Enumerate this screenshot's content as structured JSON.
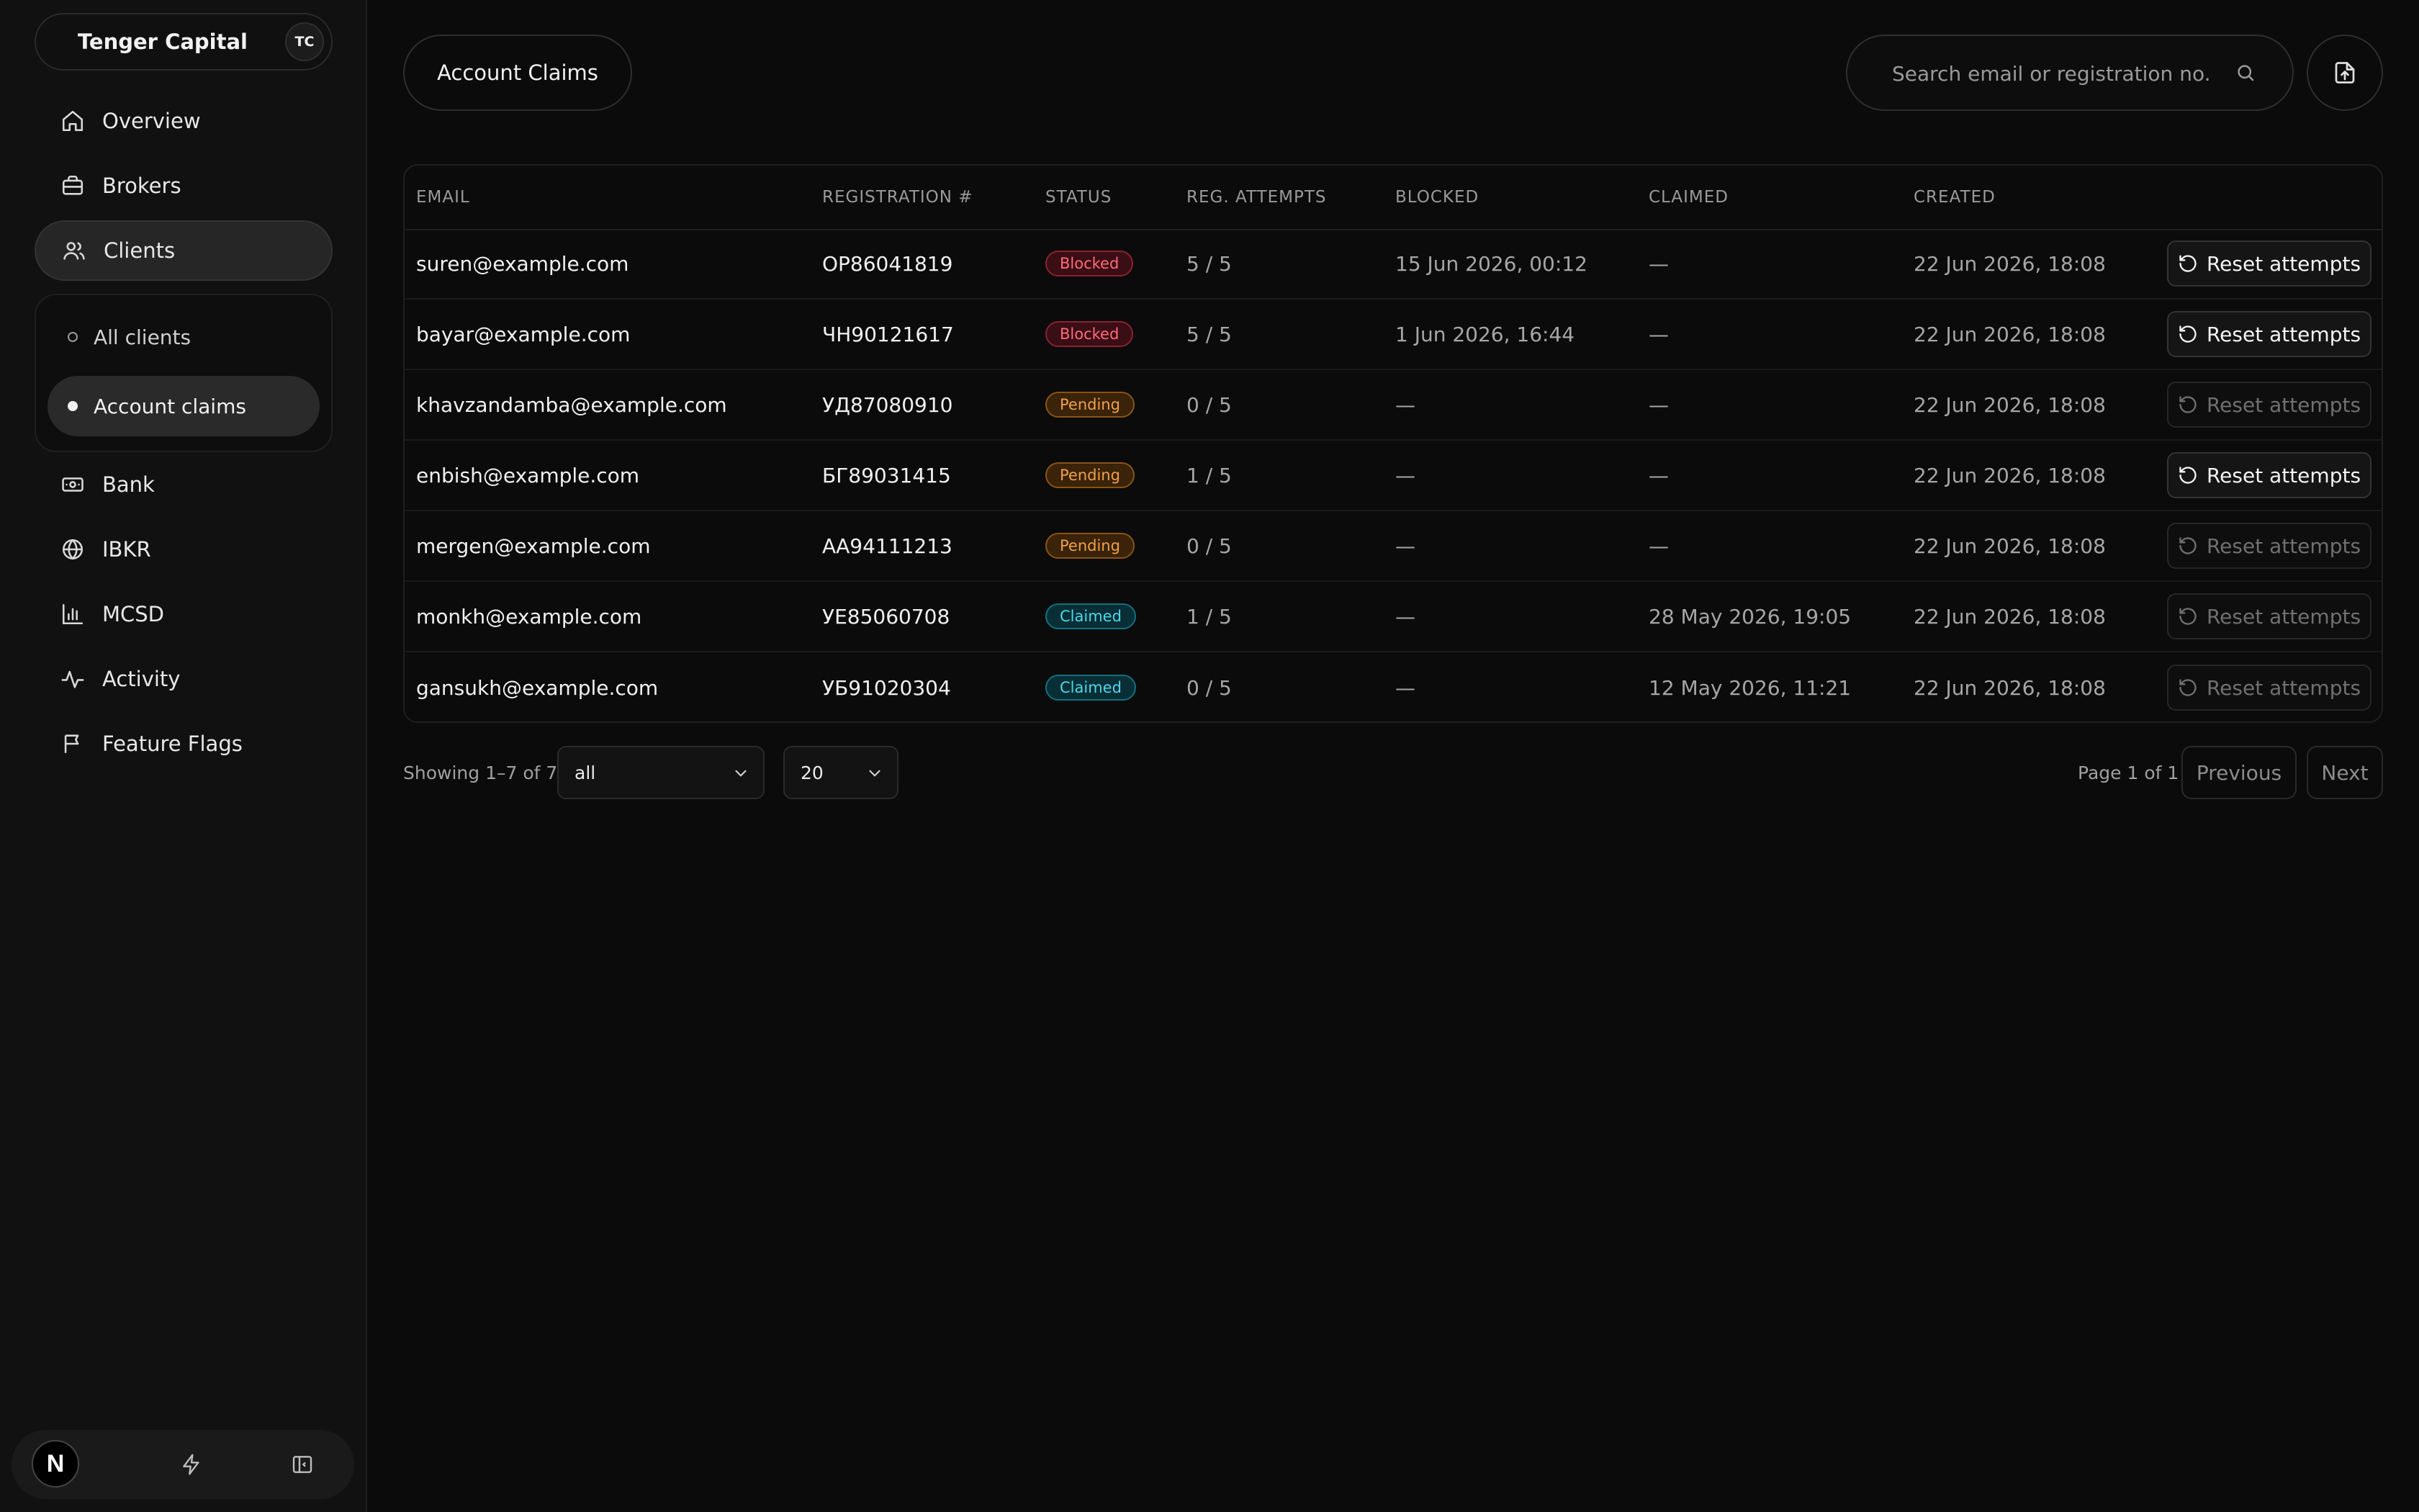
{
  "sidebar": {
    "brand_name": "Tenger Capital",
    "brand_initials": "TC",
    "nav": {
      "overview": "Overview",
      "brokers": "Brokers",
      "clients": "Clients",
      "bank": "Bank",
      "ibkr": "IBKR",
      "mcsd": "MCSD",
      "activity": "Activity",
      "feature_flags": "Feature Flags"
    },
    "clients_sub": {
      "all_clients": "All clients",
      "account_claims": "Account claims"
    },
    "footer_logo": "N"
  },
  "header": {
    "page_title": "Account Claims",
    "search_placeholder": "Search email or registration no."
  },
  "table": {
    "columns": [
      "EMAIL",
      "REGISTRATION #",
      "STATUS",
      "REG. ATTEMPTS",
      "BLOCKED",
      "CLAIMED",
      "CREATED"
    ],
    "action_label": "Reset attempts",
    "rows": [
      {
        "email": "suren@example.com",
        "reg": "ОР86041819",
        "status": "Blocked",
        "attempts": "5 / 5",
        "blocked": "15 Jun 2026, 00:12",
        "claimed": "—",
        "created": "22 Jun 2026, 18:08",
        "reset_enabled": true
      },
      {
        "email": "bayar@example.com",
        "reg": "ЧН90121617",
        "status": "Blocked",
        "attempts": "5 / 5",
        "blocked": "1 Jun 2026, 16:44",
        "claimed": "—",
        "created": "22 Jun 2026, 18:08",
        "reset_enabled": true
      },
      {
        "email": "khavzandamba@example.com",
        "reg": "УД87080910",
        "status": "Pending",
        "attempts": "0 / 5",
        "blocked": "—",
        "claimed": "—",
        "created": "22 Jun 2026, 18:08",
        "reset_enabled": false
      },
      {
        "email": "enbish@example.com",
        "reg": "БГ89031415",
        "status": "Pending",
        "attempts": "1 / 5",
        "blocked": "—",
        "claimed": "—",
        "created": "22 Jun 2026, 18:08",
        "reset_enabled": true
      },
      {
        "email": "mergen@example.com",
        "reg": "АА94111213",
        "status": "Pending",
        "attempts": "0 / 5",
        "blocked": "—",
        "claimed": "—",
        "created": "22 Jun 2026, 18:08",
        "reset_enabled": false
      },
      {
        "email": "monkh@example.com",
        "reg": "УЕ85060708",
        "status": "Claimed",
        "attempts": "1 / 5",
        "blocked": "—",
        "claimed": "28 May 2026, 19:05",
        "created": "22 Jun 2026, 18:08",
        "reset_enabled": false
      },
      {
        "email": "gansukh@example.com",
        "reg": "УБ91020304",
        "status": "Claimed",
        "attempts": "0 / 5",
        "blocked": "—",
        "claimed": "12 May 2026, 11:21",
        "created": "22 Jun 2026, 18:08",
        "reset_enabled": false
      }
    ]
  },
  "pagination": {
    "showing": "Showing 1–7 of 7",
    "status_filter": "all",
    "page_size": "20",
    "page_info": "Page 1 of 1",
    "previous": "Previous",
    "next": "Next"
  },
  "colors": {
    "background": "#0b0b0b",
    "blocked": "#ff6b7a",
    "pending": "#f0a04b",
    "claimed": "#4fd6e8"
  }
}
